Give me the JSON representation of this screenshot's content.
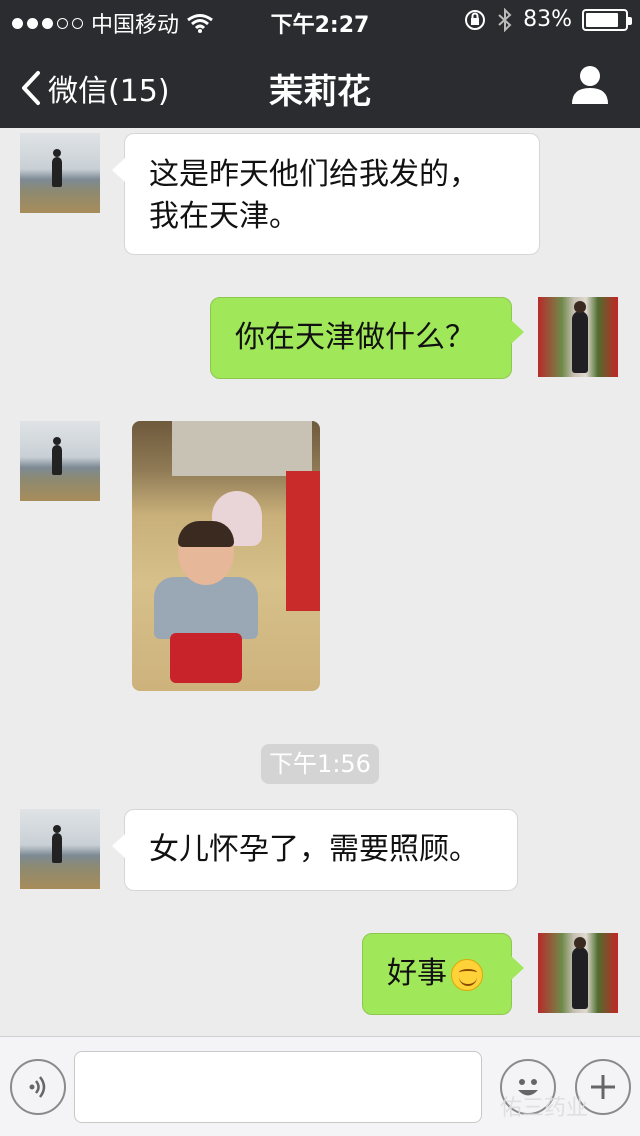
{
  "status_bar": {
    "carrier": "中国移动",
    "time": "下午2:27",
    "battery": "83%",
    "battery_level": 0.83
  },
  "nav": {
    "back_label": "微信(15)",
    "title": "茉莉花"
  },
  "messages": [
    {
      "direction": "in",
      "lines": [
        "这是昨天他们给我发的，",
        "我在天津。"
      ]
    },
    {
      "direction": "out",
      "text": "你在天津做什么？"
    },
    {
      "direction": "in",
      "type": "image"
    },
    {
      "direction": "in",
      "text": "女儿怀孕了，需要照顾。"
    },
    {
      "direction": "out",
      "text": "好事"
    }
  ],
  "timestamp": "下午1:56",
  "input": {
    "placeholder": ""
  },
  "watermark": "佑三药业",
  "icons": [
    "wifi-icon",
    "lock-rotation-icon",
    "bluetooth-icon",
    "battery-icon",
    "back-chevron-icon",
    "profile-icon",
    "voice-icon",
    "emoji-icon",
    "plus-icon",
    "smiley-emoji"
  ]
}
